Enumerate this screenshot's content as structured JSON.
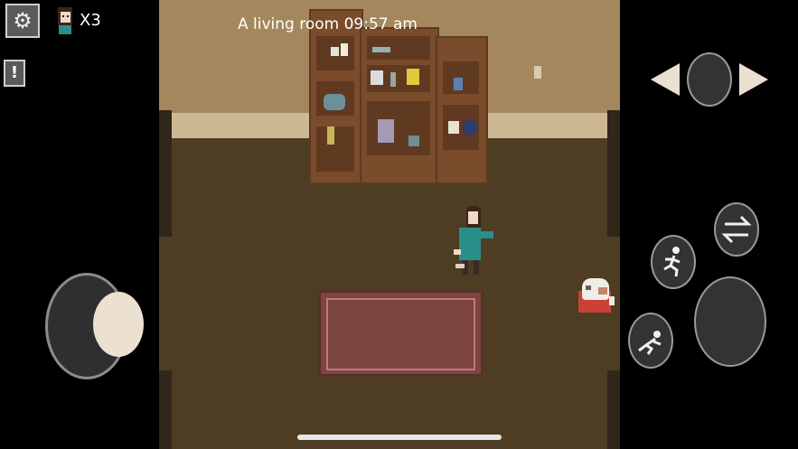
{
  "hud": {
    "location_text": "A living room 09:57 am",
    "lives_text": "X3",
    "alert_symbol": "!",
    "settings_symbol": "⚙"
  },
  "icons": {
    "settings": "gear-icon",
    "alert": "exclamation-icon",
    "player_portrait": "girl-portrait-icon",
    "prev": "arrow-left-icon",
    "next": "arrow-right-icon",
    "swap": "swap-arrows-icon",
    "run": "running-person-icon",
    "crouch": "crouching-person-icon"
  },
  "colors": {
    "wall": "#a4875d",
    "floor": "#4e3d22",
    "rug": "#7c4540",
    "character_shirt": "#2a8f88"
  }
}
